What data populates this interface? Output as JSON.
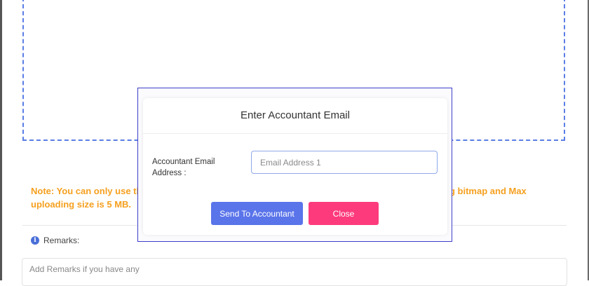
{
  "upload": {
    "note_left": "Note: You can only use th",
    "note_left_line2": "uploading size is 5 MB.",
    "note_right": "g bitmap and Max"
  },
  "remarks": {
    "label": "Remarks:",
    "placeholder": "Add Remarks if you have any"
  },
  "modal": {
    "title": "Enter Accountant Email",
    "field_label": "Accountant Email Address :",
    "email_placeholder": "Email Address 1",
    "send_label": "Send To Accountant",
    "close_label": "Close"
  },
  "colors": {
    "accent": "#5a74ea",
    "danger": "#fd3b7c",
    "note": "#f5a01f",
    "dropzone_border": "#5b7ee5"
  },
  "icons": {
    "remarks": "info-icon"
  }
}
